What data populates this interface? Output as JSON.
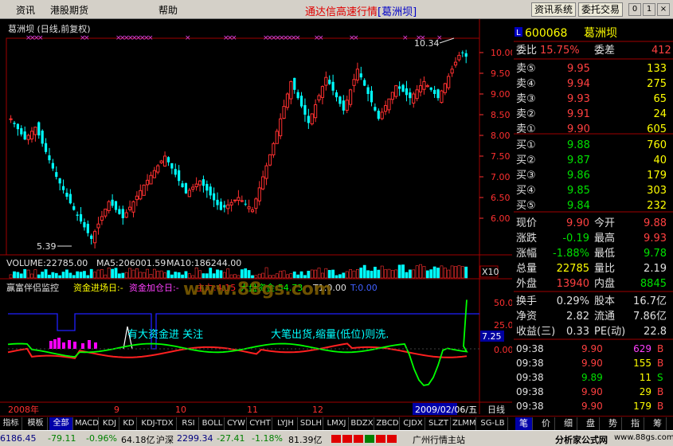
{
  "menu": [
    "资讯",
    "港股期货",
    "帮助"
  ],
  "app_title": "通达信高速行情",
  "app_stock": "[葛洲坝]",
  "buttons": {
    "info": "资讯系统",
    "trade": "委托交易"
  },
  "window_controls": {
    "minimize": "0",
    "restore": "1",
    "close": "×"
  },
  "chart_title": "葛洲坝 (日线,前复权)",
  "price_axis": [
    "10.00",
    "9.50",
    "9.00",
    "8.50",
    "8.00",
    "7.50",
    "7.00",
    "6.50",
    "6.00"
  ],
  "price_high_label": "10.34",
  "price_low_label": "5.39",
  "volume_line": {
    "volume": "VOLUME:22785.00",
    "ma5": "MA5:206001.59",
    "ma10": "MA10:186244.00"
  },
  "volume_scale": "X10",
  "indicator_line": {
    "name": "赢富伴侣监控",
    "a": "资金进场日:-",
    "b": "资金加仓日:-",
    "c": "主力:4.15",
    "d": "大盘资金:54.73",
    "e": "T1:0.00",
    "f": "T:0.00"
  },
  "watermark": "www.88gs.com",
  "indicator_axis": [
    "50.00",
    "25.00",
    "0.00"
  ],
  "indicator_current": "7.25",
  "annotations": {
    "a": "有大资金进 关注",
    "b": "大笔出货,缩量(低位)则洗."
  },
  "x_axis": [
    "2008年",
    "9",
    "10",
    "11",
    "12"
  ],
  "cursor_date": "2009/02/06/五",
  "period": "日线",
  "chart_data": {
    "type": "candlestick",
    "title": "葛洲坝 (日线,前复权)",
    "period": "daily",
    "ylim": [
      5.3,
      10.4
    ],
    "y_ticks": [
      6.0,
      6.5,
      7.0,
      7.5,
      8.0,
      8.5,
      9.0,
      9.5,
      10.0
    ],
    "x_labels": [
      "2008年",
      "9",
      "10",
      "11",
      "12"
    ],
    "high": 10.34,
    "low": 5.39,
    "series": [
      {
        "name": "VOLUME",
        "last": 22785.0
      },
      {
        "name": "MA5",
        "last": 206001.59
      },
      {
        "name": "MA10",
        "last": 186244.0
      },
      {
        "name": "主力",
        "last": 4.15
      },
      {
        "name": "大盘资金",
        "last": 54.73
      },
      {
        "name": "T1",
        "last": 0.0
      },
      {
        "name": "T",
        "last": 0.0
      }
    ],
    "indicator_ylim": [
      -25,
      60
    ],
    "indicator_ticks": [
      0,
      25,
      50
    ]
  },
  "quote": {
    "code": "600068",
    "name": "葛洲坝",
    "wb_label": "委比",
    "wb": "15.75%",
    "wc_label": "委差",
    "wc": "412",
    "asks": [
      {
        "label": "卖⑤",
        "price": "9.95",
        "vol": "133"
      },
      {
        "label": "卖④",
        "price": "9.94",
        "vol": "275"
      },
      {
        "label": "卖③",
        "price": "9.93",
        "vol": "65"
      },
      {
        "label": "卖②",
        "price": "9.91",
        "vol": "24"
      },
      {
        "label": "卖①",
        "price": "9.90",
        "vol": "605"
      }
    ],
    "bids": [
      {
        "label": "买①",
        "price": "9.88",
        "vol": "760"
      },
      {
        "label": "买②",
        "price": "9.87",
        "vol": "40"
      },
      {
        "label": "买③",
        "price": "9.86",
        "vol": "179"
      },
      {
        "label": "买④",
        "price": "9.85",
        "vol": "303"
      },
      {
        "label": "买⑤",
        "price": "9.84",
        "vol": "232"
      }
    ],
    "stats": [
      {
        "l1": "现价",
        "v1": "9.90",
        "c1": "#ff4040",
        "l2": "今开",
        "v2": "9.88",
        "c2": "#ff4040"
      },
      {
        "l1": "涨跌",
        "v1": "-0.19",
        "c1": "#00e000",
        "l2": "最高",
        "v2": "9.93",
        "c2": "#ff4040"
      },
      {
        "l1": "涨幅",
        "v1": "-1.88%",
        "c1": "#00e000",
        "l2": "最低",
        "v2": "9.78",
        "c2": "#00e000"
      },
      {
        "l1": "总量",
        "v1": "22785",
        "c1": "#ffff00",
        "l2": "量比",
        "v2": "2.19",
        "c2": "#e0e0e0"
      },
      {
        "l1": "外盘",
        "v1": "13940",
        "c1": "#ff4040",
        "l2": "内盘",
        "v2": "8845",
        "c2": "#00e000"
      }
    ],
    "extra": [
      {
        "l1": "换手",
        "v1": "0.29%",
        "l2": "股本",
        "v2": "16.7亿"
      },
      {
        "l1": "净资",
        "v1": "2.82",
        "l2": "流通",
        "v2": "7.86亿"
      },
      {
        "l1": "收益(三)",
        "v1": "0.33",
        "l2": "PE(动)",
        "v2": "22.8"
      }
    ],
    "ticks": [
      {
        "time": "09:38",
        "price": "9.90",
        "vol": "629",
        "bs": "B",
        "vc": "#ff40ff",
        "bc": "#ff4040"
      },
      {
        "time": "09:38",
        "price": "9.90",
        "vol": "155",
        "bs": "B",
        "vc": "#ffff00",
        "bc": "#ff4040"
      },
      {
        "time": "09:38",
        "price": "9.89",
        "vol": "11",
        "bs": "S",
        "vc": "#ffff00",
        "bc": "#00e000"
      },
      {
        "time": "09:38",
        "price": "9.90",
        "vol": "29",
        "bs": "B",
        "vc": "#ffff00",
        "bc": "#ff4040"
      },
      {
        "time": "09:38",
        "price": "9.90",
        "vol": "179",
        "bs": "B",
        "vc": "#ffff00",
        "bc": "#ff4040"
      }
    ]
  },
  "tabs": [
    "指标",
    "模板",
    "全部",
    "MACD",
    "KDJ",
    "KD",
    "KDJ-TDX",
    "RSI",
    "BOLL",
    "CYW",
    "CYHT",
    "LYJH",
    "SDLH",
    "LMXJ",
    "BDZX",
    "ZBCD",
    "CJDX",
    "SLZT",
    "ZLMM",
    "SG-LB"
  ],
  "right_tabs": [
    "笔",
    "价",
    "细",
    "盘",
    "势",
    "指",
    "筹"
  ],
  "status": {
    "idx1_val": "6186.45",
    "idx1_chg": "-79.11",
    "idx1_pct": "-0.96%",
    "idx1_amt": "64.18亿",
    "idx2_name": "沪深",
    "idx2_val": "2299.34",
    "idx2_chg": "-27.41",
    "idx2_pct": "-1.18%",
    "idx2_amt": "81.39亿",
    "server": "广州行情主站",
    "site": "分析家公式网",
    "site_url": "www.88gs.com"
  }
}
